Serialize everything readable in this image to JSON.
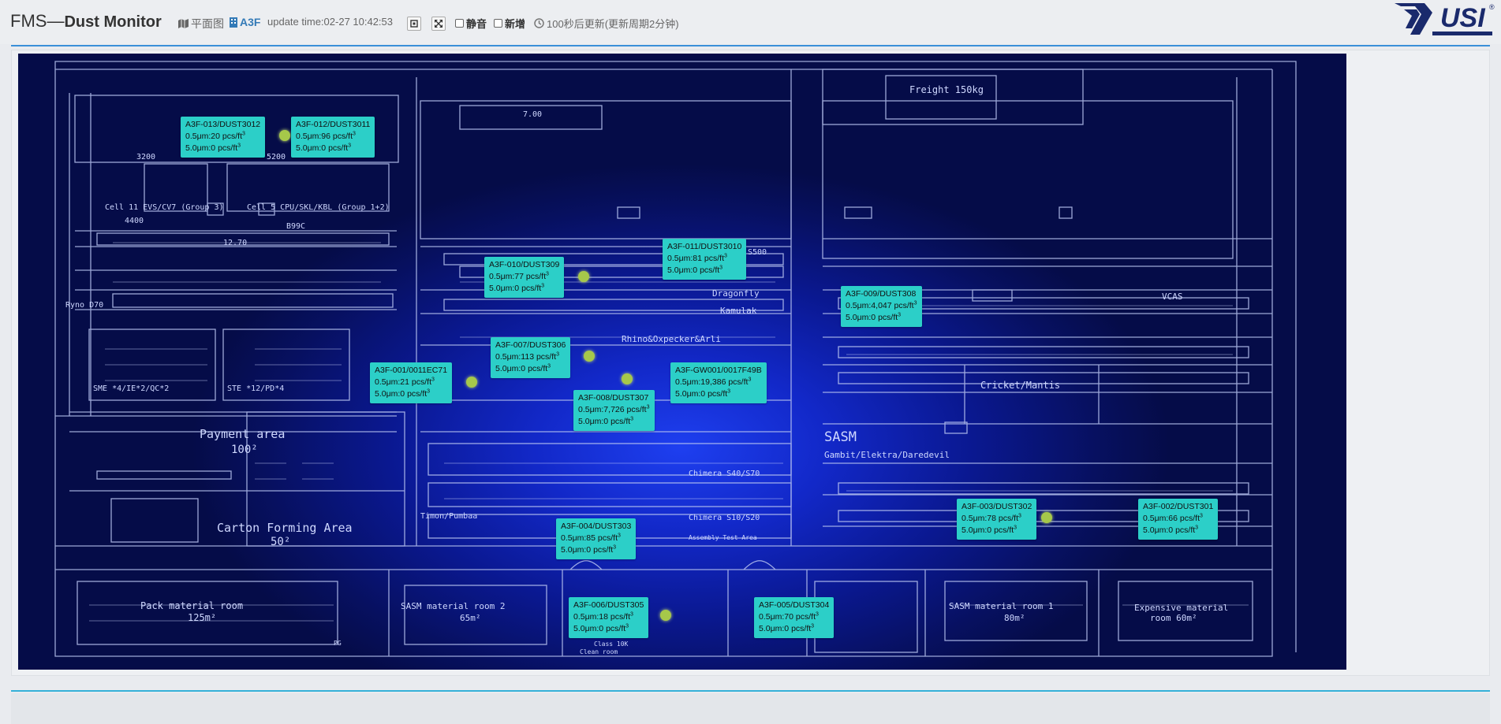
{
  "header": {
    "title_prefix": "FMS—",
    "title_main": "Dust Monitor",
    "plan_view_label": "平面图",
    "floor_label": "A3F",
    "update_time": "update time:02-27 10:42:53",
    "mute_label": "静音",
    "new_label": "新增",
    "countdown_text": "100秒后更新(更新周期2分钟)",
    "logo_text": "USI",
    "logo_mark": "®"
  },
  "map": {
    "labels": {
      "cell": "Cell 11 EVS/CV7 (Group 3)",
      "cell5": "Cell 5 CPU/SKL/KBL (Group 1+2)",
      "dim1": "3200",
      "dim2": "5200",
      "dim3": "4400",
      "dim4": "B99C",
      "dim5": "12.70",
      "dim6": "7.00",
      "sme": "SME *4/IE*2/QC*2",
      "ste": "STE *12/PD*4",
      "payment": "Payment area",
      "payment_area": "100²",
      "carton": "Carton Forming  Area",
      "carton_area": "50²",
      "pack": "Pack material room",
      "pack_area": "125m²",
      "sasm2": "SASM material room 2",
      "sasm2_area": "65m²",
      "sasm1": "SASM material room 1",
      "sasm1_area": "80m²",
      "expensive": "Expensive material",
      "expensive_area": "room 60m²",
      "dragonfly": "Dragonfly",
      "kamulak": "Kamulak",
      "rhino": "Rhino&Oxpecker&Arli",
      "cricket": "Cricket/Mantis",
      "sasm": "SASM",
      "gambit": "Gambit/Elektra/Daredevil",
      "chimera1": "Chimera S40/S70",
      "chimera2": "Chimera S10/S20",
      "timon": "Timon/Pumbaa",
      "assembly": "Assembly Test Area",
      "vcas": "VCAS",
      "ryno": "Ryno D70",
      "s500": "S500",
      "elevator": "Freight 150kg",
      "pg": "PG",
      "class": "Class 10K",
      "clean": "Clean room"
    }
  },
  "sensors": [
    {
      "id": "A3F-013/DUST3012",
      "pm05": "0.5μm:20 pcs/ft",
      "pm50": "5.0μm:0 pcs/ft",
      "unit_exp": "3"
    },
    {
      "id": "A3F-012/DUST3011",
      "pm05": "0.5μm:96 pcs/ft",
      "pm50": "5.0μm:0 pcs/ft",
      "unit_exp": "3"
    },
    {
      "id": "A3F-011/DUST3010",
      "pm05": "0.5μm:81 pcs/ft",
      "pm50": "5.0μm:0 pcs/ft",
      "unit_exp": "3"
    },
    {
      "id": "A3F-010/DUST309",
      "pm05": "0.5μm:77 pcs/ft",
      "pm50": "5.0μm:0 pcs/ft",
      "unit_exp": "3"
    },
    {
      "id": "A3F-009/DUST308",
      "pm05": "0.5μm:4,047 pcs/ft",
      "pm50": "5.0μm:0 pcs/ft",
      "unit_exp": "3"
    },
    {
      "id": "A3F-007/DUST306",
      "pm05": "0.5μm:113 pcs/ft",
      "pm50": "5.0μm:0 pcs/ft",
      "unit_exp": "3"
    },
    {
      "id": "A3F-001/0011EC71",
      "pm05": "0.5μm:21 pcs/ft",
      "pm50": "5.0μm:0 pcs/ft",
      "unit_exp": "3"
    },
    {
      "id": "A3F-GW001/0017F49B",
      "pm05": "0.5μm:19,386 pcs/ft",
      "pm50": "5.0μm:0 pcs/ft",
      "unit_exp": "3"
    },
    {
      "id": "A3F-008/DUST307",
      "pm05": "0.5μm:7,726 pcs/ft",
      "pm50": "5.0μm:0 pcs/ft",
      "unit_exp": "3"
    },
    {
      "id": "A3F-003/DUST302",
      "pm05": "0.5μm:78 pcs/ft",
      "pm50": "5.0μm:0 pcs/ft",
      "unit_exp": "3"
    },
    {
      "id": "A3F-002/DUST301",
      "pm05": "0.5μm:66 pcs/ft",
      "pm50": "5.0μm:0 pcs/ft",
      "unit_exp": "3"
    },
    {
      "id": "A3F-004/DUST303",
      "pm05": "0.5μm:85 pcs/ft",
      "pm50": "5.0μm:0 pcs/ft",
      "unit_exp": "3"
    },
    {
      "id": "A3F-006/DUST305",
      "pm05": "0.5μm:18 pcs/ft",
      "pm50": "5.0μm:0 pcs/ft",
      "unit_exp": "3"
    },
    {
      "id": "A3F-005/DUST304",
      "pm05": "0.5μm:70 pcs/ft",
      "pm50": "5.0μm:0 pcs/ft",
      "unit_exp": "3"
    }
  ],
  "colors": {
    "tag_bg": "#2ccfc8",
    "marker": "#a6c84a",
    "accent": "#3a8fd9",
    "logo": "#1a2a6c"
  }
}
